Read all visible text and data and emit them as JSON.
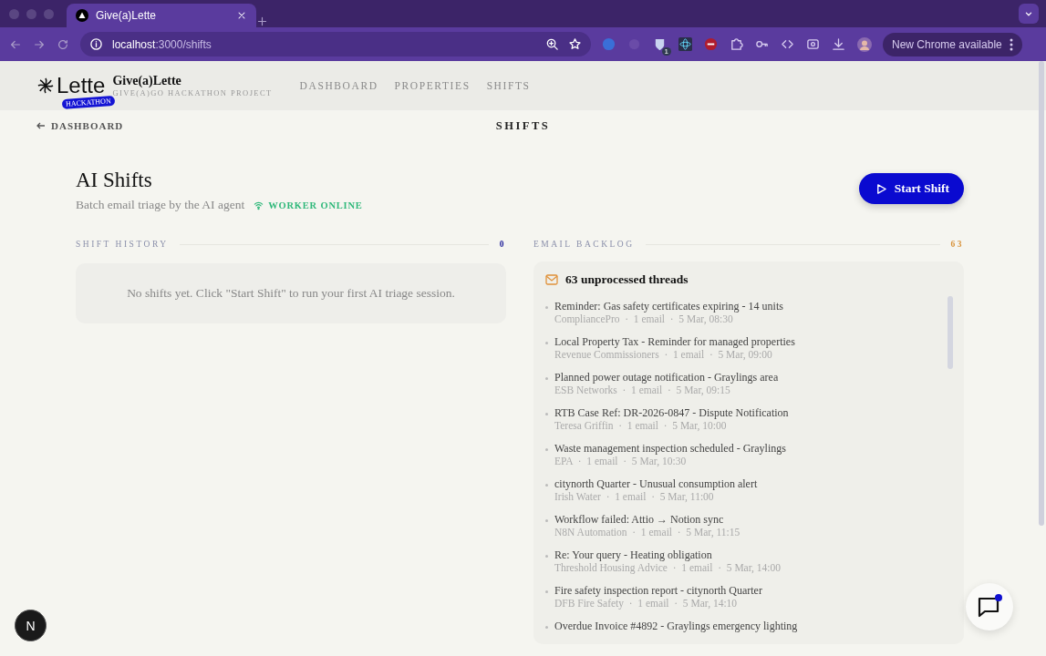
{
  "browser": {
    "tab_title": "Give(a)Lette",
    "url_host": "localhost",
    "url_path": ":3000/shifts",
    "extension_badge": "1",
    "update_label": "New Chrome available"
  },
  "header": {
    "logo_word": "Lette",
    "logo_badge": "HACKATHON",
    "brand": "Give(a)Lette",
    "subtitle": "GIVE(A)GO HACKATHON PROJECT",
    "nav": [
      {
        "label": "DASHBOARD",
        "selected": false
      },
      {
        "label": "PROPERTIES",
        "selected": false
      },
      {
        "label": "SHIFTS",
        "selected": false
      }
    ]
  },
  "subheader": {
    "back_link": "DASHBOARD",
    "page_title": "SHIFTS"
  },
  "hero": {
    "title": "AI Shifts",
    "subtitle": "Batch email triage by the AI agent",
    "status": "WORKER ONLINE",
    "start_button": "Start Shift"
  },
  "shift_history": {
    "label": "SHIFT HISTORY",
    "count": "0",
    "empty_message": "No shifts yet. Click \"Start Shift\" to run your first AI triage session."
  },
  "email_backlog": {
    "label": "EMAIL BACKLOG",
    "count": "63",
    "summary": "63 unprocessed threads",
    "threads": [
      {
        "subject": "Reminder: Gas safety certificates expiring - 14 units",
        "meta": "CompliancePro  ·  1 email  ·  5 Mar, 08:30"
      },
      {
        "subject": "Local Property Tax - Reminder for managed properties",
        "meta": "Revenue Commissioners  ·  1 email  ·  5 Mar, 09:00"
      },
      {
        "subject": "Planned power outage notification - Graylings area",
        "meta": "ESB Networks  ·  1 email  ·  5 Mar, 09:15"
      },
      {
        "subject": "RTB Case Ref: DR-2026-0847 - Dispute Notification",
        "meta": "Teresa Griffin  ·  1 email  ·  5 Mar, 10:00"
      },
      {
        "subject": "Waste management inspection scheduled - Graylings",
        "meta": "EPA  ·  1 email  ·  5 Mar, 10:30"
      },
      {
        "subject": "citynorth Quarter - Unusual consumption alert",
        "meta": "Irish Water  ·  1 email  ·  5 Mar, 11:00"
      },
      {
        "subject": "Workflow failed: Attio → Notion sync",
        "meta": "N8N Automation  ·  1 email  ·  5 Mar, 11:15"
      },
      {
        "subject": "Re: Your query - Heating obligation",
        "meta": "Threshold Housing Advice  ·  1 email  ·  5 Mar, 14:00"
      },
      {
        "subject": "Fire safety inspection report - citynorth Quarter",
        "meta": "DFB Fire Safety  ·  1 email  ·  5 Mar, 14:10"
      },
      {
        "subject": "Overdue Invoice #4892 - Graylings emergency lighting"
      }
    ]
  },
  "dev_badge": "N"
}
